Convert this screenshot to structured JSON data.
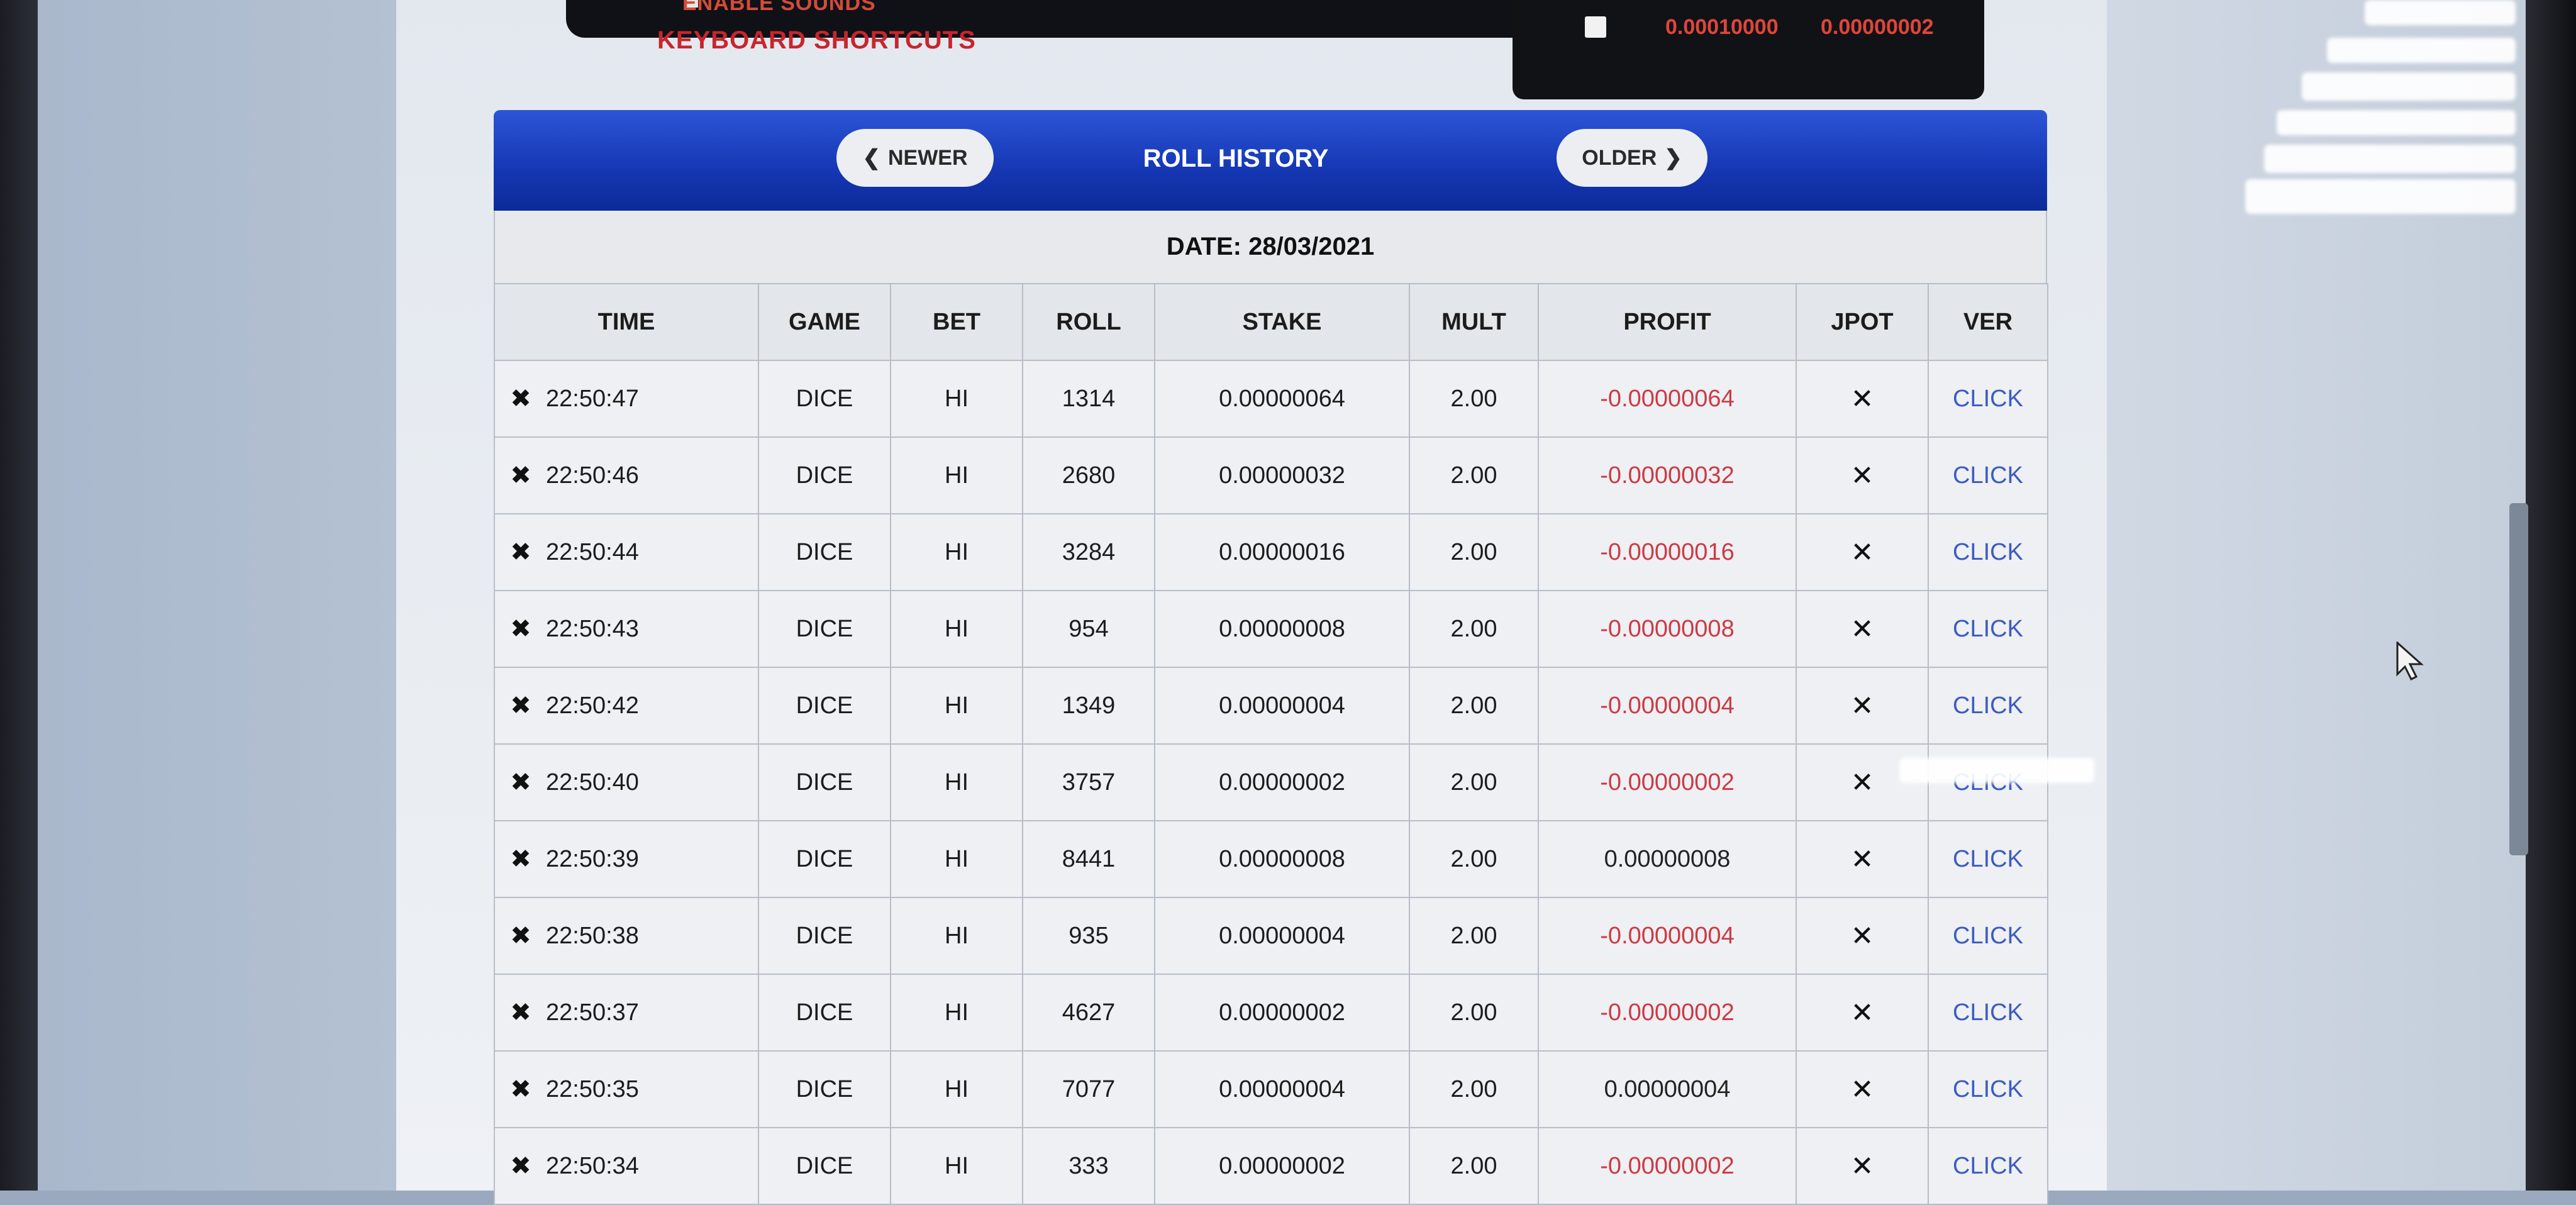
{
  "top": {
    "enable_sounds": "ENABLE SOUNDS",
    "keyboard_shortcuts": "KEYBOARD SHORTCUTS",
    "value_1": "0.00010000",
    "value_2": "0.00000002"
  },
  "history": {
    "newer_label": "NEWER",
    "title": "ROLL HISTORY",
    "older_label": "OLDER",
    "date": "DATE: 28/03/2021",
    "columns": [
      "TIME",
      "GAME",
      "BET",
      "ROLL",
      "STAKE",
      "MULT",
      "PROFIT",
      "JPOT",
      "VER"
    ],
    "rows": [
      {
        "time": "22:50:47",
        "game": "DICE",
        "bet": "HI",
        "roll": "1314",
        "stake": "0.00000064",
        "mult": "2.00",
        "profit": "-0.00000064",
        "jpot": "✕",
        "ver": "CLICK",
        "negative": true
      },
      {
        "time": "22:50:46",
        "game": "DICE",
        "bet": "HI",
        "roll": "2680",
        "stake": "0.00000032",
        "mult": "2.00",
        "profit": "-0.00000032",
        "jpot": "✕",
        "ver": "CLICK",
        "negative": true
      },
      {
        "time": "22:50:44",
        "game": "DICE",
        "bet": "HI",
        "roll": "3284",
        "stake": "0.00000016",
        "mult": "2.00",
        "profit": "-0.00000016",
        "jpot": "✕",
        "ver": "CLICK",
        "negative": true
      },
      {
        "time": "22:50:43",
        "game": "DICE",
        "bet": "HI",
        "roll": "954",
        "stake": "0.00000008",
        "mult": "2.00",
        "profit": "-0.00000008",
        "jpot": "✕",
        "ver": "CLICK",
        "negative": true
      },
      {
        "time": "22:50:42",
        "game": "DICE",
        "bet": "HI",
        "roll": "1349",
        "stake": "0.00000004",
        "mult": "2.00",
        "profit": "-0.00000004",
        "jpot": "✕",
        "ver": "CLICK",
        "negative": true
      },
      {
        "time": "22:50:40",
        "game": "DICE",
        "bet": "HI",
        "roll": "3757",
        "stake": "0.00000002",
        "mult": "2.00",
        "profit": "-0.00000002",
        "jpot": "✕",
        "ver": "CLICK",
        "negative": true
      },
      {
        "time": "22:50:39",
        "game": "DICE",
        "bet": "HI",
        "roll": "8441",
        "stake": "0.00000008",
        "mult": "2.00",
        "profit": "0.00000008",
        "jpot": "✕",
        "ver": "CLICK",
        "negative": false
      },
      {
        "time": "22:50:38",
        "game": "DICE",
        "bet": "HI",
        "roll": "935",
        "stake": "0.00000004",
        "mult": "2.00",
        "profit": "-0.00000004",
        "jpot": "✕",
        "ver": "CLICK",
        "negative": true
      },
      {
        "time": "22:50:37",
        "game": "DICE",
        "bet": "HI",
        "roll": "4627",
        "stake": "0.00000002",
        "mult": "2.00",
        "profit": "-0.00000002",
        "jpot": "✕",
        "ver": "CLICK",
        "negative": true
      },
      {
        "time": "22:50:35",
        "game": "DICE",
        "bet": "HI",
        "roll": "7077",
        "stake": "0.00000004",
        "mult": "2.00",
        "profit": "0.00000004",
        "jpot": "✕",
        "ver": "CLICK",
        "negative": false
      },
      {
        "time": "22:50:34",
        "game": "DICE",
        "bet": "HI",
        "roll": "333",
        "stake": "0.00000002",
        "mult": "2.00",
        "profit": "-0.00000002",
        "jpot": "✕",
        "ver": "CLICK",
        "negative": true
      }
    ]
  },
  "icons": {
    "row_game_icon": "dice-icon",
    "newer": "chevron-left-icon",
    "older": "chevron-right-icon"
  },
  "colors": {
    "header_blue": "#1537b4",
    "loss_red": "#cc3a45",
    "link_blue": "#3c5bc2"
  }
}
